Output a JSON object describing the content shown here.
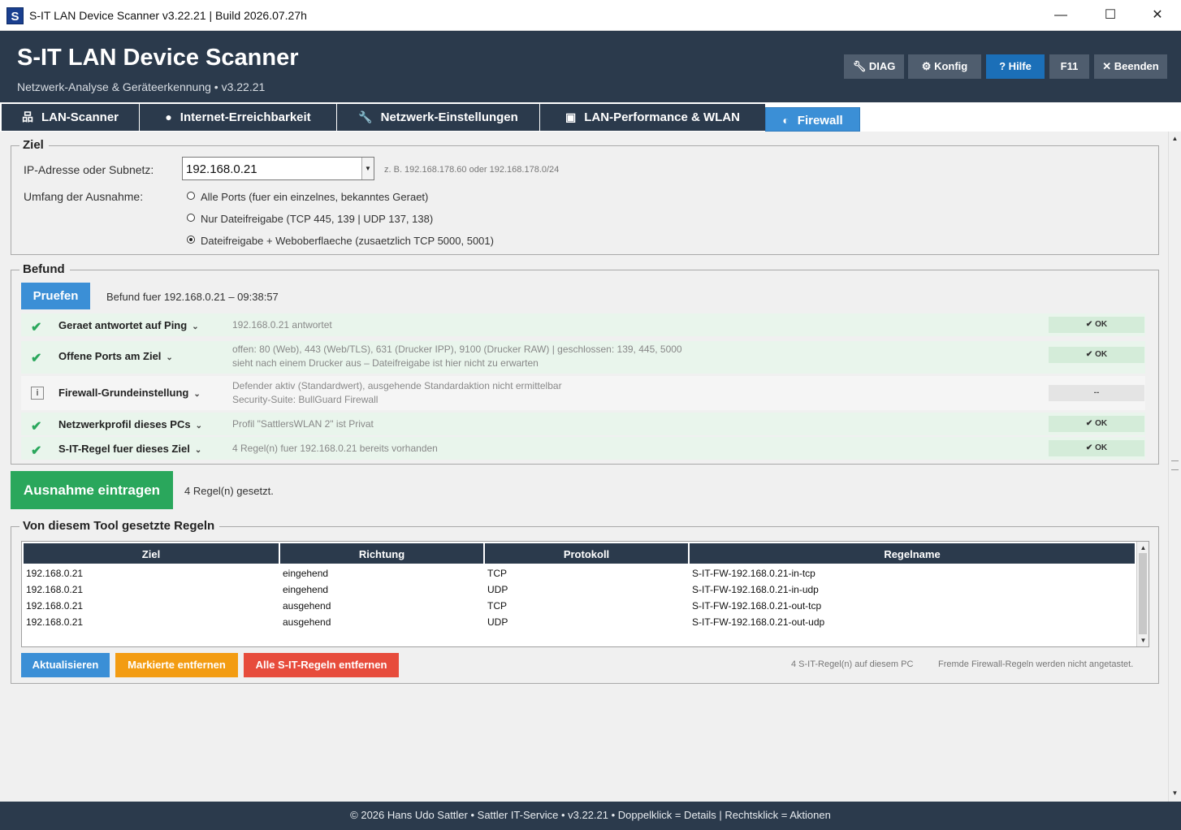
{
  "window": {
    "title": "S-IT LAN Device Scanner v3.22.21 | Build 2026.07.27h",
    "icon_letter": "S",
    "minimize": "—",
    "maximize": "☐",
    "close": "✕"
  },
  "header": {
    "app_name": "S-IT LAN Device Scanner",
    "subtitle": "Netzwerk-Analyse & Geräteerkennung  •  v3.22.21",
    "buttons": {
      "diag": "DIAG",
      "konfig": "Konfig",
      "hilfe": "? Hilfe",
      "f11": "F11",
      "beenden": "Beenden"
    }
  },
  "tabs": [
    {
      "label": "LAN-Scanner",
      "icon": "network-icon",
      "glyph": "品"
    },
    {
      "label": "Internet-Erreichbarkeit",
      "icon": "search-icon",
      "glyph": "●"
    },
    {
      "label": "Netzwerk-Einstellungen",
      "icon": "wrench-icon",
      "glyph": "🔧"
    },
    {
      "label": "LAN-Performance & WLAN",
      "icon": "monitor-icon",
      "glyph": "▣"
    },
    {
      "label": "Firewall",
      "icon": "shield-icon",
      "glyph": "◐",
      "active": true
    }
  ],
  "ziel": {
    "title": "Ziel",
    "ip_label": "IP-Adresse oder Subnetz:",
    "ip_value": "192.168.0.21",
    "ip_hint": "z. B. 192.168.178.60  oder  192.168.178.0/24",
    "scope_label": "Umfang der Ausnahme:",
    "options": [
      {
        "label": "Alle Ports  (fuer ein einzelnes, bekanntes Geraet)",
        "checked": false
      },
      {
        "label": "Nur Dateifreigabe  (TCP 445, 139 | UDP 137, 138)",
        "checked": false
      },
      {
        "label": "Dateifreigabe + Weboberflaeche  (zusaetzlich TCP 5000, 5001)",
        "checked": true
      }
    ]
  },
  "befund": {
    "title": "Befund",
    "check_button": "Pruefen",
    "caption": "Befund fuer 192.168.0.21 – 09:38:57",
    "rows": [
      {
        "title": "Geraet antwortet auf Ping",
        "detail": [
          "192.168.0.21 antwortet"
        ],
        "status": "✔ OK",
        "state": "ok"
      },
      {
        "title": "Offene Ports am Ziel",
        "detail": [
          "offen: 80 (Web), 443 (Web/TLS), 631 (Drucker IPP), 9100 (Drucker RAW)  |  geschlossen: 139, 445, 5000",
          "sieht nach einem Drucker aus – Dateifreigabe ist hier nicht zu erwarten"
        ],
        "status": "✔ OK",
        "state": "ok"
      },
      {
        "title": "Firewall-Grundeinstellung",
        "detail": [
          "Defender aktiv (Standardwert), ausgehende Standardaktion nicht ermittelbar",
          "Security-Suite: BullGuard Firewall"
        ],
        "status": "--",
        "state": "neutral"
      },
      {
        "title": "Netzwerkprofil dieses PCs",
        "detail": [
          "Profil \"SattlersWLAN 2\" ist Privat"
        ],
        "status": "✔ OK",
        "state": "ok"
      },
      {
        "title": "S-IT-Regel fuer dieses Ziel",
        "detail": [
          "4 Regel(n) fuer 192.168.0.21 bereits vorhanden"
        ],
        "status": "✔ OK",
        "state": "ok"
      }
    ],
    "chevron": "⌄",
    "info_glyph": "i",
    "check_glyph": "✔"
  },
  "apply": {
    "button": "Ausnahme eintragen",
    "status": "4 Regel(n) gesetzt."
  },
  "rules": {
    "title": "Von diesem Tool gesetzte Regeln",
    "columns": [
      "Ziel",
      "Richtung",
      "Protokoll",
      "Regelname"
    ],
    "rows": [
      [
        "192.168.0.21",
        "eingehend",
        "TCP",
        "S-IT-FW-192.168.0.21-in-tcp"
      ],
      [
        "192.168.0.21",
        "eingehend",
        "UDP",
        "S-IT-FW-192.168.0.21-in-udp"
      ],
      [
        "192.168.0.21",
        "ausgehend",
        "TCP",
        "S-IT-FW-192.168.0.21-out-tcp"
      ],
      [
        "192.168.0.21",
        "ausgehend",
        "UDP",
        "S-IT-FW-192.168.0.21-out-udp"
      ]
    ],
    "buttons": {
      "refresh": "Aktualisieren",
      "remove_marked": "Markierte entfernen",
      "remove_all": "Alle S-IT-Regeln entfernen"
    },
    "count_text": "4 S-IT-Regel(n) auf diesem PC",
    "note": "Fremde Firewall-Regeln werden nicht angetastet."
  },
  "footer": {
    "text": "© 2026 Hans Udo Sattler  •  Sattler IT-Service  •  v3.22.21  •  Doppelklick = Details   |   Rechtsklick = Aktionen"
  },
  "colors": {
    "header_bg": "#2b3a4c",
    "accent_blue": "#3b8fd6",
    "ok_green": "#2aa75c",
    "warn_orange": "#f39c12",
    "danger_red": "#e74c3c"
  }
}
